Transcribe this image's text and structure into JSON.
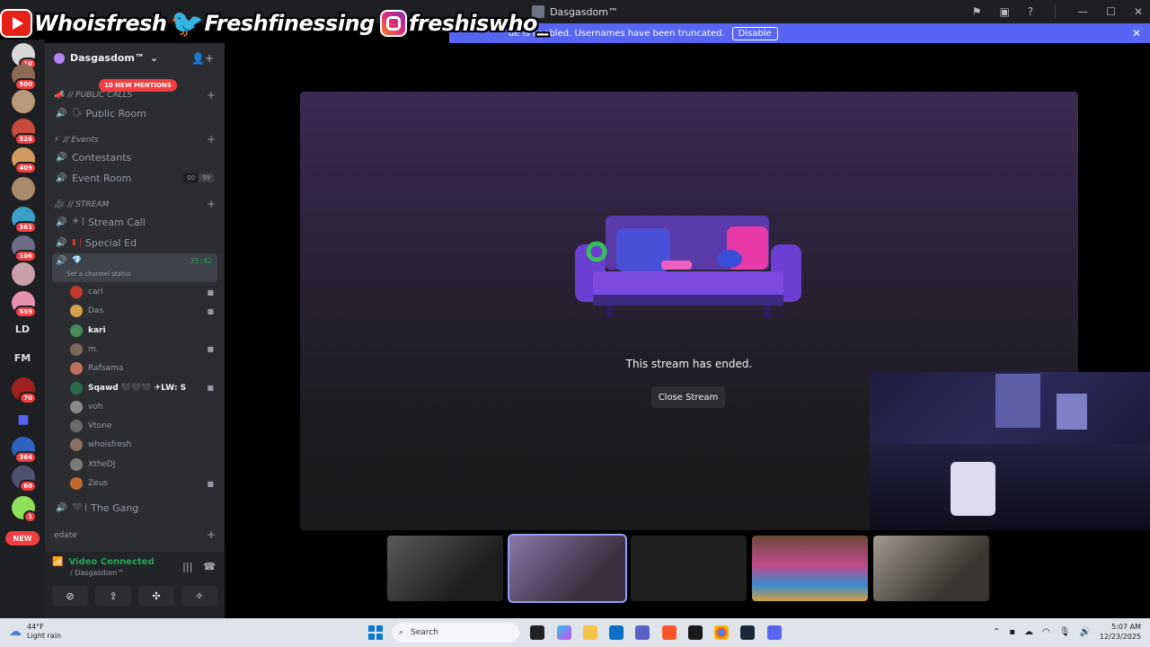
{
  "window": {
    "title": "Dasgasdom™"
  },
  "social": {
    "youtube": "Whoisfresh",
    "twitter": "Freshfinessing",
    "instagram": "freshiswho_"
  },
  "banner": {
    "message": "de is enabled. Usernames have been truncated.",
    "disable_label": "Disable",
    "close": "✕"
  },
  "rail": {
    "servers": [
      {
        "badge": "10",
        "color": "#d8d8d8"
      },
      {
        "badge": "500",
        "color": "#8c6a55"
      },
      {
        "badge": "",
        "color": "#b89a7a"
      },
      {
        "badge": "526",
        "color": "#c84b3c"
      },
      {
        "badge": "409",
        "color": "#d09a60"
      },
      {
        "badge": "",
        "color": "#a88a6e"
      },
      {
        "badge": "361",
        "color": "#3aa0c8"
      },
      {
        "badge": "106",
        "color": "#6d6d8a"
      },
      {
        "badge": "",
        "color": "#c8a0a8"
      },
      {
        "badge": "559",
        "color": "#e890b0"
      }
    ],
    "text_servers": [
      "LD",
      "FM"
    ],
    "lower_servers": [
      {
        "badge": "70",
        "color": "#a02020"
      },
      {
        "badge": "",
        "color": "#5865f2"
      },
      {
        "badge": "364",
        "color": "#3060c0"
      },
      {
        "badge": "68",
        "color": "#505070"
      },
      {
        "badge": "1",
        "color": "#8de05a"
      }
    ],
    "new_label": "NEW"
  },
  "sidebar": {
    "server_name": "Dasgasdom™",
    "mentions_label": "10 NEW MENTIONS",
    "categories": [
      {
        "label": "// PUBLIC CALLS"
      },
      {
        "label": "// Events"
      },
      {
        "label": "// STREAM"
      }
    ],
    "channels": {
      "public_room": "Public Room",
      "contestants": "Contestants",
      "event_room": "Event Room",
      "event_room_counts": [
        "00",
        "99"
      ],
      "stream_call": "Stream Call",
      "special_ed": "Special Ed",
      "active_timer": "35:42",
      "active_status": "Set a channel status",
      "the_gang": "The Gang",
      "edate": "edate"
    },
    "users": [
      {
        "name": "carl",
        "bright": false,
        "video": true,
        "color": "#c0392b"
      },
      {
        "name": "Das",
        "bright": false,
        "video": true,
        "color": "#d4a04a"
      },
      {
        "name": "kari",
        "bright": true,
        "video": false,
        "color": "#4a8a5a"
      },
      {
        "name": "m.",
        "bright": false,
        "video": true,
        "color": "#7a6a5a"
      },
      {
        "name": "Rafsama",
        "bright": false,
        "video": false,
        "color": "#c07060"
      },
      {
        "name": "Sqawd 🖤🖤🖤 ✈LW: S",
        "bright": true,
        "video": true,
        "color": "#2a6a4a"
      },
      {
        "name": "voh",
        "bright": false,
        "video": false,
        "color": "#8a8a8a"
      },
      {
        "name": "Vtone",
        "bright": false,
        "video": false,
        "color": "#6a6a6a"
      },
      {
        "name": "whoisfresh",
        "bright": false,
        "video": false,
        "color": "#8a7060"
      },
      {
        "name": "XtheDJ",
        "bright": false,
        "video": false,
        "color": "#7a7a7a"
      },
      {
        "name": "Zeus",
        "bright": false,
        "video": true,
        "color": "#c06a30"
      }
    ],
    "voice": {
      "connected_label": "Video Connected",
      "sub_label": "/ Dasgasdom™"
    }
  },
  "stream": {
    "ended_text": "This stream has ended.",
    "close_label": "Close Stream"
  },
  "taskbar": {
    "temp": "44°F",
    "condition": "Light rain",
    "search_placeholder": "Search",
    "time": "5:07 AM",
    "date": "12/23/2025"
  }
}
